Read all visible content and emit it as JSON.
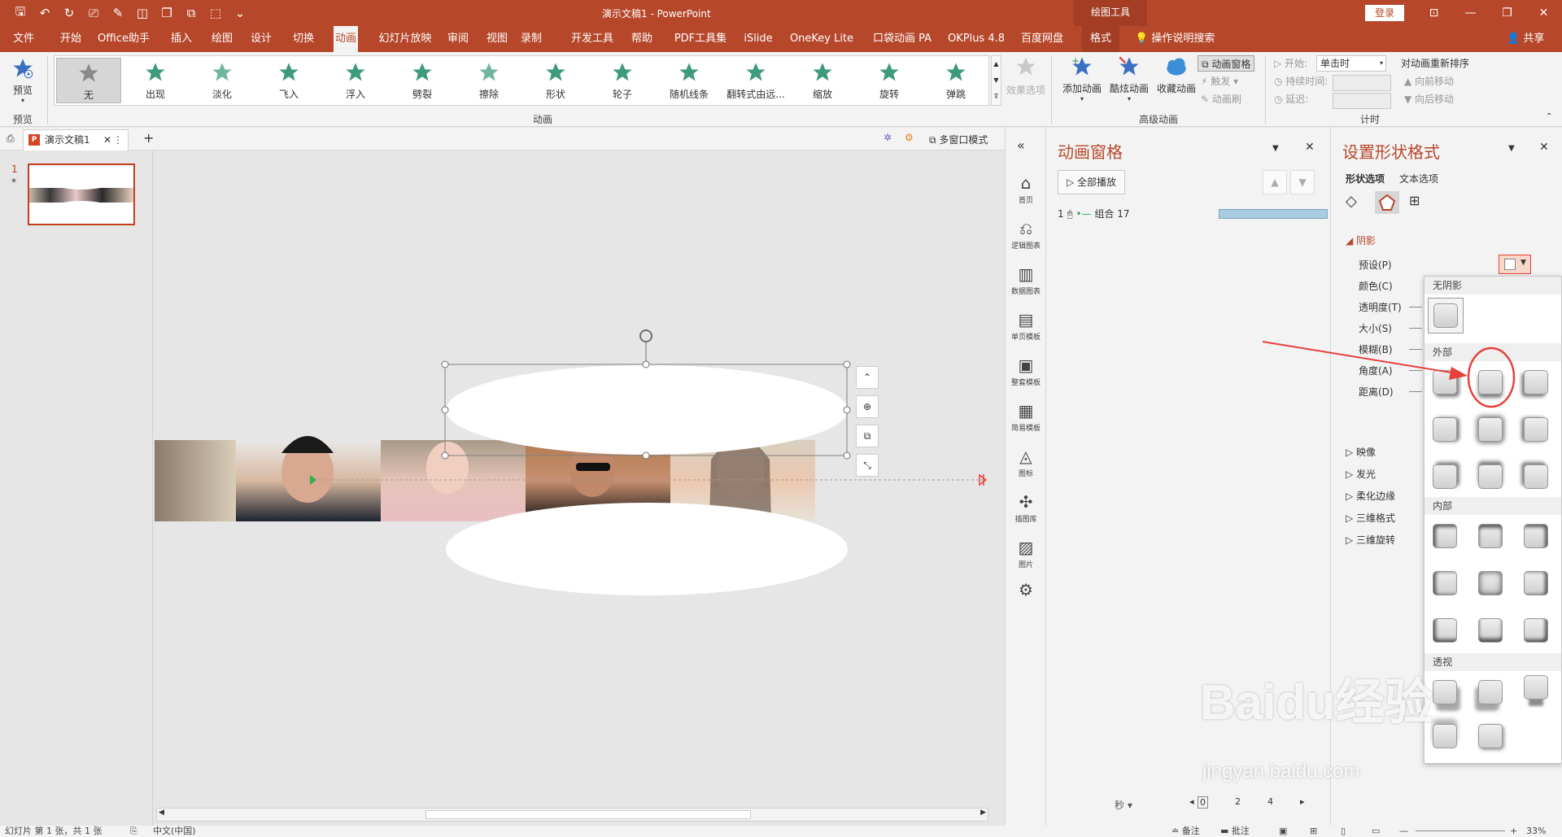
{
  "window": {
    "title": "演示文稿1 - PowerPoint",
    "context_tab_group": "绘图工具",
    "login": "登录",
    "share": "共享"
  },
  "tabs": [
    {
      "label": "文件",
      "state": "normal"
    },
    {
      "label": "开始",
      "state": "normal"
    },
    {
      "label": "Office助手",
      "state": "normal"
    },
    {
      "label": "插入",
      "state": "normal"
    },
    {
      "label": "绘图",
      "state": "normal"
    },
    {
      "label": "设计",
      "state": "normal"
    },
    {
      "label": "切换",
      "state": "normal"
    },
    {
      "label": "动画",
      "state": "active"
    },
    {
      "label": "幻灯片放映",
      "state": "normal"
    },
    {
      "label": "审阅",
      "state": "normal"
    },
    {
      "label": "视图",
      "state": "normal"
    },
    {
      "label": "录制",
      "state": "normal"
    },
    {
      "label": "开发工具",
      "state": "normal"
    },
    {
      "label": "帮助",
      "state": "normal"
    },
    {
      "label": "PDF工具集",
      "state": "normal"
    },
    {
      "label": "iSlide",
      "state": "normal"
    },
    {
      "label": "OneKey Lite",
      "state": "normal"
    },
    {
      "label": "口袋动画 PA",
      "state": "normal"
    },
    {
      "label": "OKPlus 4.8",
      "state": "normal"
    },
    {
      "label": "百度网盘",
      "state": "normal"
    },
    {
      "label": "格式",
      "state": "contextual"
    }
  ],
  "tell_me": "操作说明搜索",
  "ribbon": {
    "preview": {
      "label": "预览",
      "group": "预览"
    },
    "animations_group": "动画",
    "animations": [
      {
        "label": "无",
        "color": "#8a8a8a",
        "selected": true
      },
      {
        "label": "出现",
        "color": "#3d9a7a",
        "selected": false
      },
      {
        "label": "淡化",
        "color": "#6fb6a0",
        "selected": false
      },
      {
        "label": "飞入",
        "color": "#3d9a7a",
        "selected": false
      },
      {
        "label": "浮入",
        "color": "#3d9a7a",
        "selected": false
      },
      {
        "label": "劈裂",
        "color": "#3d9a7a",
        "selected": false
      },
      {
        "label": "擦除",
        "color": "#6fb6a0",
        "selected": false
      },
      {
        "label": "形状",
        "color": "#3d9a7a",
        "selected": false
      },
      {
        "label": "轮子",
        "color": "#3d9a7a",
        "selected": false
      },
      {
        "label": "随机线条",
        "color": "#3d9a7a",
        "selected": false
      },
      {
        "label": "翻转式由远...",
        "color": "#3d9a7a",
        "selected": false
      },
      {
        "label": "缩放",
        "color": "#3d9a7a",
        "selected": false
      },
      {
        "label": "旋转",
        "color": "#3d9a7a",
        "selected": false
      },
      {
        "label": "弹跳",
        "color": "#3d9a7a",
        "selected": false
      }
    ],
    "effect_options": "效果选项",
    "advanced_group": "高级动画",
    "add_animation": "添加动画",
    "cool_animation": "酷炫动画",
    "favorite_animation": "收藏动画",
    "animation_pane_btn": "动画窗格",
    "trigger": "触发",
    "animation_painter": "动画刷",
    "timing_group": "计时",
    "start_label": "开始:",
    "start_value": "单击时",
    "duration_label": "持续时间:",
    "delay_label": "延迟:",
    "reorder_title": "对动画重新排序",
    "move_earlier": "向前移动",
    "move_later": "向后移动"
  },
  "doc_tabs": {
    "name": "演示文稿1",
    "multi_window": "多窗口模式"
  },
  "slides": [
    {
      "number": "1",
      "marker": "*"
    }
  ],
  "side_tools": [
    "首页",
    "逻辑图表",
    "数据图表",
    "单页模板",
    "整套模板",
    "简易模板",
    "图标",
    "插图库",
    "图片"
  ],
  "animation_pane": {
    "title": "动画窗格",
    "play_all": "全部播放",
    "items": [
      {
        "index": "1",
        "name": "组合 17"
      }
    ],
    "seconds_label": "秒",
    "timeline_ticks": [
      "0",
      "2",
      "4"
    ]
  },
  "format_pane": {
    "title": "设置形状格式",
    "tab_shape": "形状选项",
    "tab_text": "文本选项",
    "section_shadow": "阴影",
    "props": [
      "预设(P)",
      "颜色(C)",
      "透明度(T)",
      "大小(S)",
      "模糊(B)",
      "角度(A)",
      "距离(D)"
    ],
    "collapsed_sections": [
      "映像",
      "发光",
      "柔化边缘",
      "三维格式",
      "三维旋转"
    ]
  },
  "shadow_presets": {
    "no_shadow": "无阴影",
    "outer": "外部",
    "inner": "内部",
    "perspective": "透视"
  },
  "status": {
    "slide_info": "幻灯片 第 1 张，共 1 张",
    "language": "中文(中国)",
    "notes": "备注",
    "comments": "批注",
    "zoom": "33%"
  },
  "watermark": {
    "logo": "Baidu经验",
    "url": "jingyan.baidu.com"
  },
  "colors": {
    "accent": "#b7472a",
    "selection": "#c43e1c",
    "arrow": "#e8413a"
  }
}
